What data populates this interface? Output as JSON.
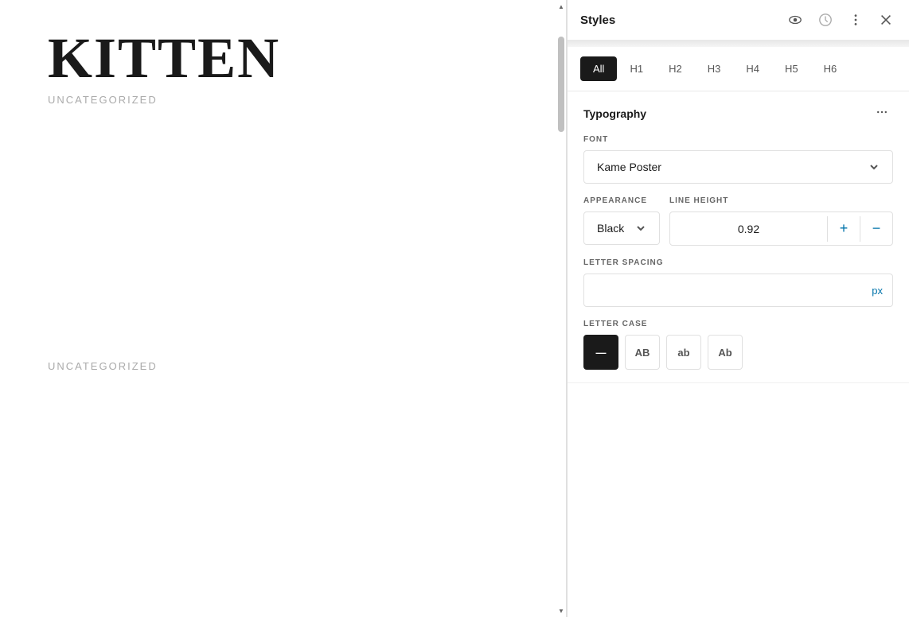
{
  "canvas": {
    "main_title": "KITTEN",
    "uncategorized_1": "UNCATEGORIZED",
    "uncategorized_2": "UNCATEGORIZED"
  },
  "styles_panel": {
    "title": "Styles",
    "icons": {
      "eye": "👁",
      "history": "🕐",
      "more": "⋮",
      "close": "✕"
    },
    "heading_tabs": [
      {
        "label": "All",
        "active": true
      },
      {
        "label": "H1",
        "active": false
      },
      {
        "label": "H2",
        "active": false
      },
      {
        "label": "H3",
        "active": false
      },
      {
        "label": "H4",
        "active": false
      },
      {
        "label": "H5",
        "active": false
      },
      {
        "label": "H6",
        "active": false
      }
    ],
    "typography": {
      "section_title": "Typography",
      "font_label": "FONT",
      "font_value": "Kame Poster",
      "appearance_label": "APPEARANCE",
      "appearance_value": "Black",
      "line_height_label": "LINE HEIGHT",
      "line_height_value": "0.92",
      "letter_spacing_label": "LETTER SPACING",
      "letter_spacing_value": "",
      "letter_spacing_unit": "px",
      "letter_case_label": "LETTER CASE",
      "letter_case_options": [
        {
          "label": "—",
          "value": "none",
          "active": true
        },
        {
          "label": "AB",
          "value": "uppercase",
          "active": false
        },
        {
          "label": "ab",
          "value": "lowercase",
          "active": false
        },
        {
          "label": "Ab",
          "value": "capitalize",
          "active": false
        }
      ]
    }
  }
}
